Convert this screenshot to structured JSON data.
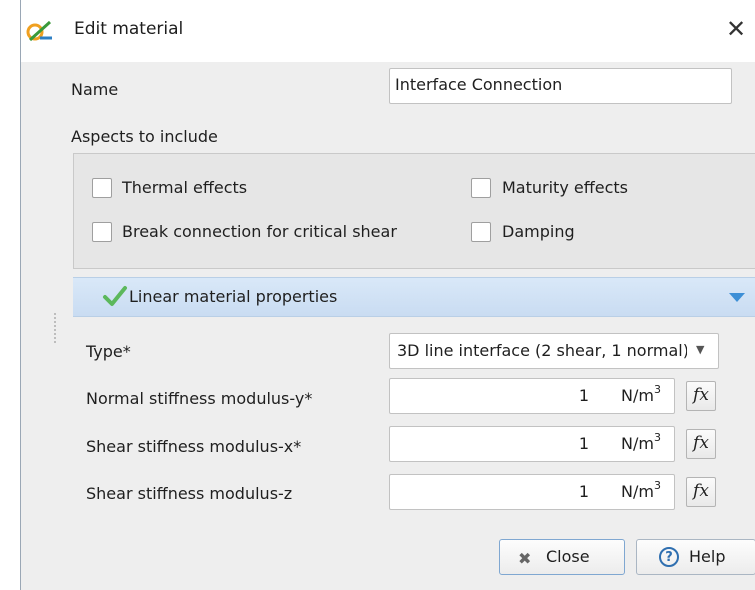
{
  "window": {
    "title": "Edit material",
    "close_glyph": "✕"
  },
  "name": {
    "label": "Name",
    "value": "Interface Connection"
  },
  "aspects": {
    "label": "Aspects to include",
    "items": [
      {
        "label": "Thermal effects",
        "checked": false
      },
      {
        "label": "Maturity effects",
        "checked": false
      },
      {
        "label": "Break connection for critical shear",
        "checked": false
      },
      {
        "label": "Damping",
        "checked": false
      }
    ]
  },
  "section": {
    "title": "Linear material properties",
    "status_icon": "check-icon",
    "collapse_icon": "triangle-down-icon"
  },
  "type": {
    "label": "Type*",
    "value": "3D line interface (2 shear, 1 normal)"
  },
  "properties": [
    {
      "label": "Normal stiffness modulus-y*",
      "value": "1",
      "unit": "N/m",
      "unit_exp": "3",
      "fx": "fx"
    },
    {
      "label": "Shear stiffness modulus-x*",
      "value": "1",
      "unit": "N/m",
      "unit_exp": "3",
      "fx": "fx"
    },
    {
      "label": "Shear stiffness modulus-z",
      "value": "1",
      "unit": "N/m",
      "unit_exp": "3",
      "fx": "fx"
    }
  ],
  "buttons": {
    "close": "Close",
    "help": "Help"
  },
  "colors": {
    "section_header": "#cfe0f4",
    "check_green": "#5cb85c",
    "collapse_blue": "#3d8fd6"
  }
}
